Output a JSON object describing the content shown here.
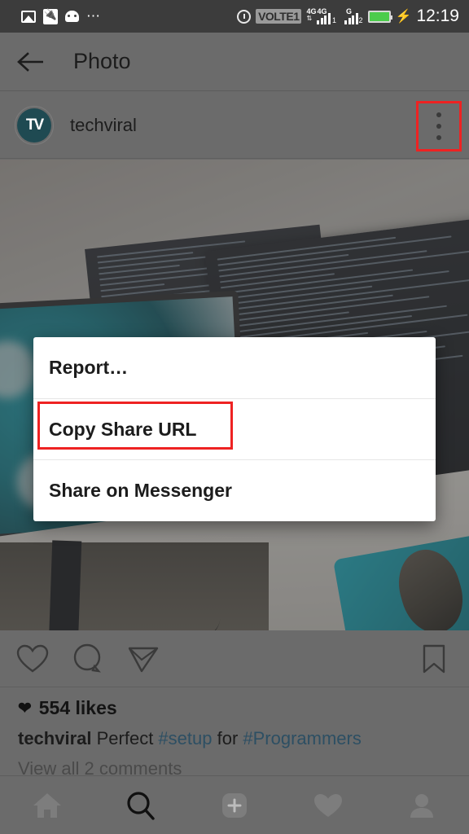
{
  "status_bar": {
    "left_icons": [
      "image-icon",
      "usb-icon",
      "android-icon",
      "more-icons"
    ],
    "alarm_icon": "alarm-icon",
    "network_label": "VOLTE1",
    "sim1_type": "4G",
    "sim1_data": "4G",
    "sim1_index": "1",
    "sim2_type": "G",
    "sim2_index": "2",
    "battery_icon": "battery-icon",
    "charging_icon": "charging-bolt-icon",
    "time": "12:19"
  },
  "app_bar": {
    "back_icon": "back-arrow-icon",
    "title": "Photo"
  },
  "post_header": {
    "avatar_text": "TV",
    "username": "techviral",
    "menu_icon": "overflow-menu-icon",
    "menu_highlight_color": "#ee2222"
  },
  "photo": {
    "alt": "desk setup with laptops and monitors showing code"
  },
  "dialog": {
    "items": [
      {
        "label": "Report…",
        "name": "dialog-item-report",
        "highlighted": false
      },
      {
        "label": "Copy Share URL",
        "name": "dialog-item-copy-share-url",
        "highlighted": true
      },
      {
        "label": "Share on Messenger",
        "name": "dialog-item-share-on-messenger",
        "highlighted": false
      }
    ],
    "highlight_color": "#ee2222"
  },
  "actions": {
    "like_icon": "heart-outline-icon",
    "comment_icon": "comment-bubble-icon",
    "share_icon": "paper-plane-icon",
    "save_icon": "bookmark-outline-icon"
  },
  "meta": {
    "likes_heart_icon": "heart-filled-icon",
    "likes_text": "554 likes",
    "caption_username": "techviral",
    "caption_text_1": " Perfect ",
    "caption_tag_1": "#setup",
    "caption_text_2": " for ",
    "caption_tag_2": "#Programmers",
    "comments_link": "View all 2 comments"
  },
  "bottom_nav": {
    "items": [
      {
        "name": "nav-home",
        "icon": "home-icon",
        "active": false
      },
      {
        "name": "nav-search",
        "icon": "search-icon",
        "active": true
      },
      {
        "name": "nav-add",
        "icon": "add-post-icon",
        "active": false
      },
      {
        "name": "nav-activity",
        "icon": "heart-icon",
        "active": false
      },
      {
        "name": "nav-profile",
        "icon": "person-icon",
        "active": false
      }
    ]
  },
  "colors": {
    "accent_red": "#ee2222",
    "battery_green": "#4ccc4c",
    "dim_overlay": "rgba(64,64,64,0.45)",
    "avatar_teal": "#1f4a52"
  }
}
